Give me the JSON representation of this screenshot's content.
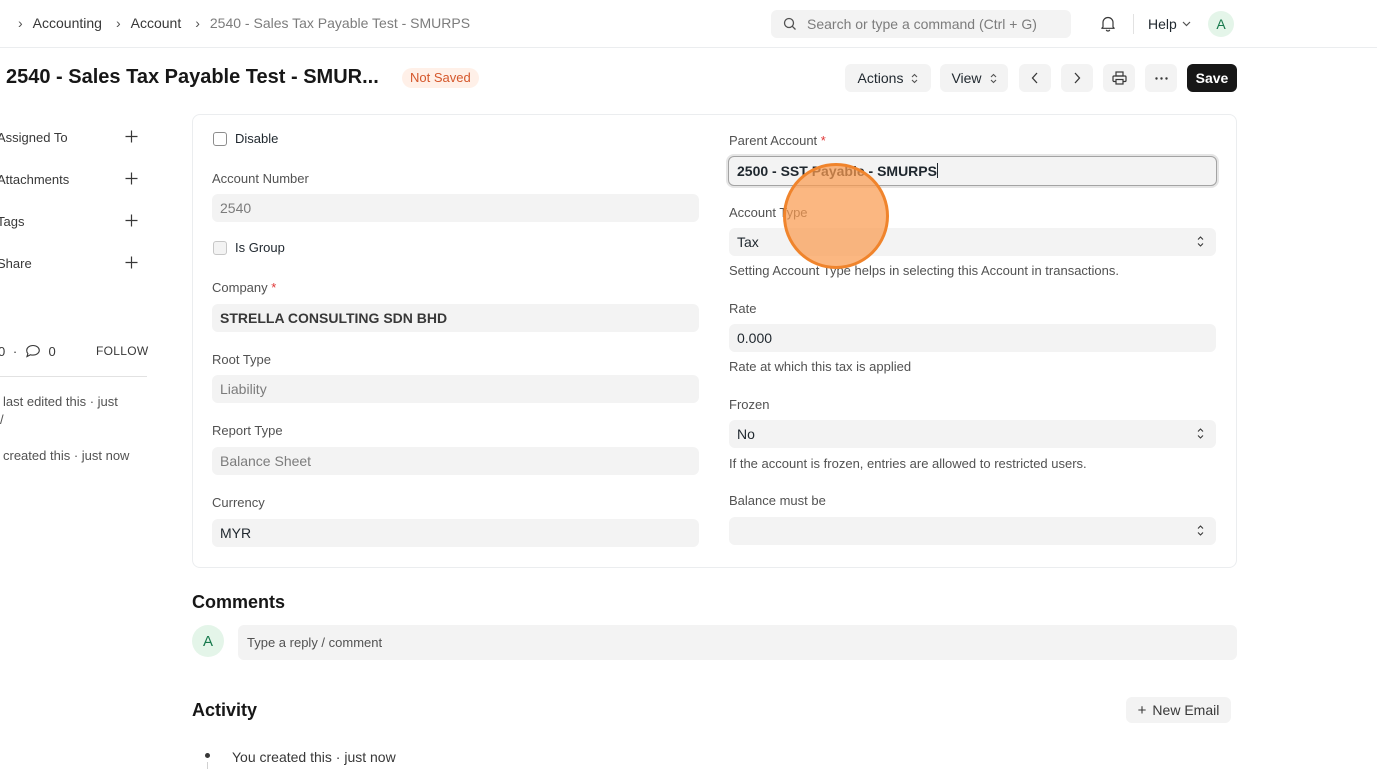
{
  "breadcrumbs": [
    "Accounting",
    "Account",
    "2540 - Sales Tax Payable Test - SMURPS"
  ],
  "search": {
    "placeholder": "Search or type a command (Ctrl + G)"
  },
  "navbar": {
    "help_label": "Help",
    "user_initial": "A"
  },
  "header": {
    "title": "2540 - Sales Tax Payable Test - SMUR...",
    "status": "Not Saved",
    "actions_label": "Actions",
    "view_label": "View",
    "save_label": "Save"
  },
  "sidebar": {
    "items": [
      {
        "label": "Assigned To"
      },
      {
        "label": "Attachments"
      },
      {
        "label": "Tags"
      },
      {
        "label": "Share"
      }
    ],
    "likes": "0",
    "comments": "0",
    "follow_label": "FOLLOW",
    "log": [
      {
        "line1": "last edited this · just",
        "line2": "/"
      },
      {
        "line1": "created this · just now"
      }
    ]
  },
  "form": {
    "disable_label": "Disable",
    "account_number_label": "Account Number",
    "account_number": "2540",
    "is_group_label": "Is Group",
    "company_label": "Company",
    "company": "STRELLA CONSULTING SDN BHD",
    "root_type_label": "Root Type",
    "root_type": "Liability",
    "report_type_label": "Report Type",
    "report_type": "Balance Sheet",
    "currency_label": "Currency",
    "currency": "MYR",
    "parent_account_label": "Parent Account",
    "parent_account": "2500 - SST Payable - SMURPS",
    "account_type_label": "Account Type",
    "account_type": "Tax",
    "account_type_help": "Setting Account Type helps in selecting this Account in transactions.",
    "rate_label": "Rate",
    "rate": "0.000",
    "rate_help": "Rate at which this tax is applied",
    "frozen_label": "Frozen",
    "frozen": "No",
    "frozen_help": "If the account is frozen, entries are allowed to restricted users.",
    "balance_label": "Balance must be",
    "balance": "",
    "required_mark": "*"
  },
  "comments": {
    "title": "Comments",
    "avatar_initial": "A",
    "placeholder": "Type a reply / comment"
  },
  "activity": {
    "title": "Activity",
    "new_email_label": "New Email",
    "entry": "You created this · just now"
  }
}
